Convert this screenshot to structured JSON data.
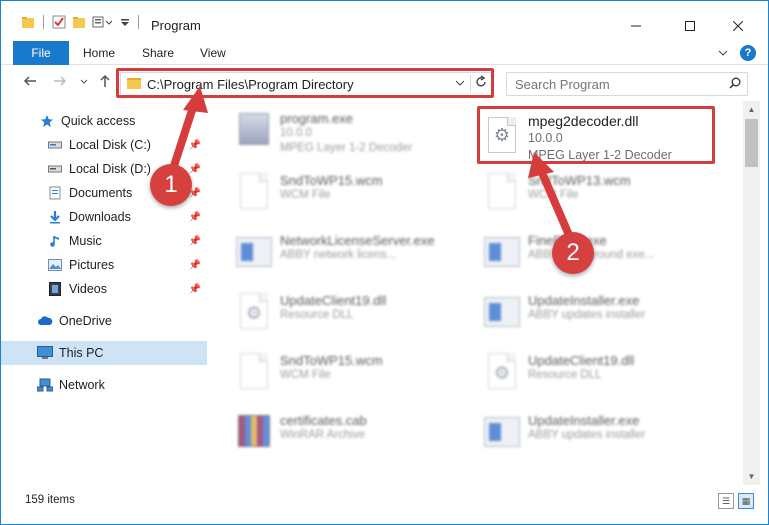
{
  "window": {
    "title": "Program"
  },
  "ribbon": {
    "tabs": [
      "File",
      "Home",
      "Share",
      "View"
    ]
  },
  "address": {
    "path": "C:\\Program Files\\Program Directory"
  },
  "search": {
    "placeholder": "Search Program"
  },
  "sidebar": {
    "items": [
      {
        "label": "Quick access",
        "icon": "star-icon"
      },
      {
        "label": "Local Disk (C:)",
        "icon": "drive-icon"
      },
      {
        "label": "Local Disk (D:)",
        "icon": "drive-icon"
      },
      {
        "label": "Documents",
        "icon": "documents-icon"
      },
      {
        "label": "Downloads",
        "icon": "download-icon"
      },
      {
        "label": "Music",
        "icon": "music-icon"
      },
      {
        "label": "Pictures",
        "icon": "pictures-icon"
      },
      {
        "label": "Videos",
        "icon": "videos-icon"
      },
      {
        "label": "OneDrive",
        "icon": "cloud-icon"
      },
      {
        "label": "This PC",
        "icon": "computer-icon"
      },
      {
        "label": "Network",
        "icon": "network-icon"
      }
    ]
  },
  "files": [
    {
      "name": "program.exe",
      "meta1": "10.0.0",
      "meta2": "MPEG Layer 1-2 Decoder",
      "icon": "exe"
    },
    {
      "name": "mpeg2decoder.dll",
      "meta1": "10.0.0",
      "meta2": "MPEG Layer 1-2 Decoder",
      "icon": "dll"
    },
    {
      "name": "SndToWP15.wcm",
      "meta1": "WCM File",
      "meta2": "",
      "icon": "doc"
    },
    {
      "name": "SndToWP13.wcm",
      "meta1": "WCM File",
      "meta2": "",
      "icon": "doc"
    },
    {
      "name": "NetworkLicenseServer.exe",
      "meta1": "ABBY network licens...",
      "meta2": "",
      "icon": "app"
    },
    {
      "name": "FineExec.exe",
      "meta1": "ABBY Background exe...",
      "meta2": "",
      "icon": "app"
    },
    {
      "name": "UpdateClient19.dll",
      "meta1": "Resource DLL",
      "meta2": "",
      "icon": "dll"
    },
    {
      "name": "UpdateInstaller.exe",
      "meta1": "ABBY updates installer",
      "meta2": "",
      "icon": "app"
    },
    {
      "name": "SndToWP15.wcm",
      "meta1": "WCM File",
      "meta2": "",
      "icon": "doc"
    },
    {
      "name": "UpdateClient19.dll",
      "meta1": "Resource DLL",
      "meta2": "",
      "icon": "dll"
    },
    {
      "name": "certificates.cab",
      "meta1": "WinRAR Archive",
      "meta2": "",
      "icon": "cab"
    },
    {
      "name": "UpdateInstaller.exe",
      "meta1": "ABBY updates installer",
      "meta2": "",
      "icon": "app"
    }
  ],
  "annotations": {
    "step1": "1",
    "step2": "2",
    "color": "#d63c3c"
  },
  "status": {
    "items_count": "159 items"
  }
}
